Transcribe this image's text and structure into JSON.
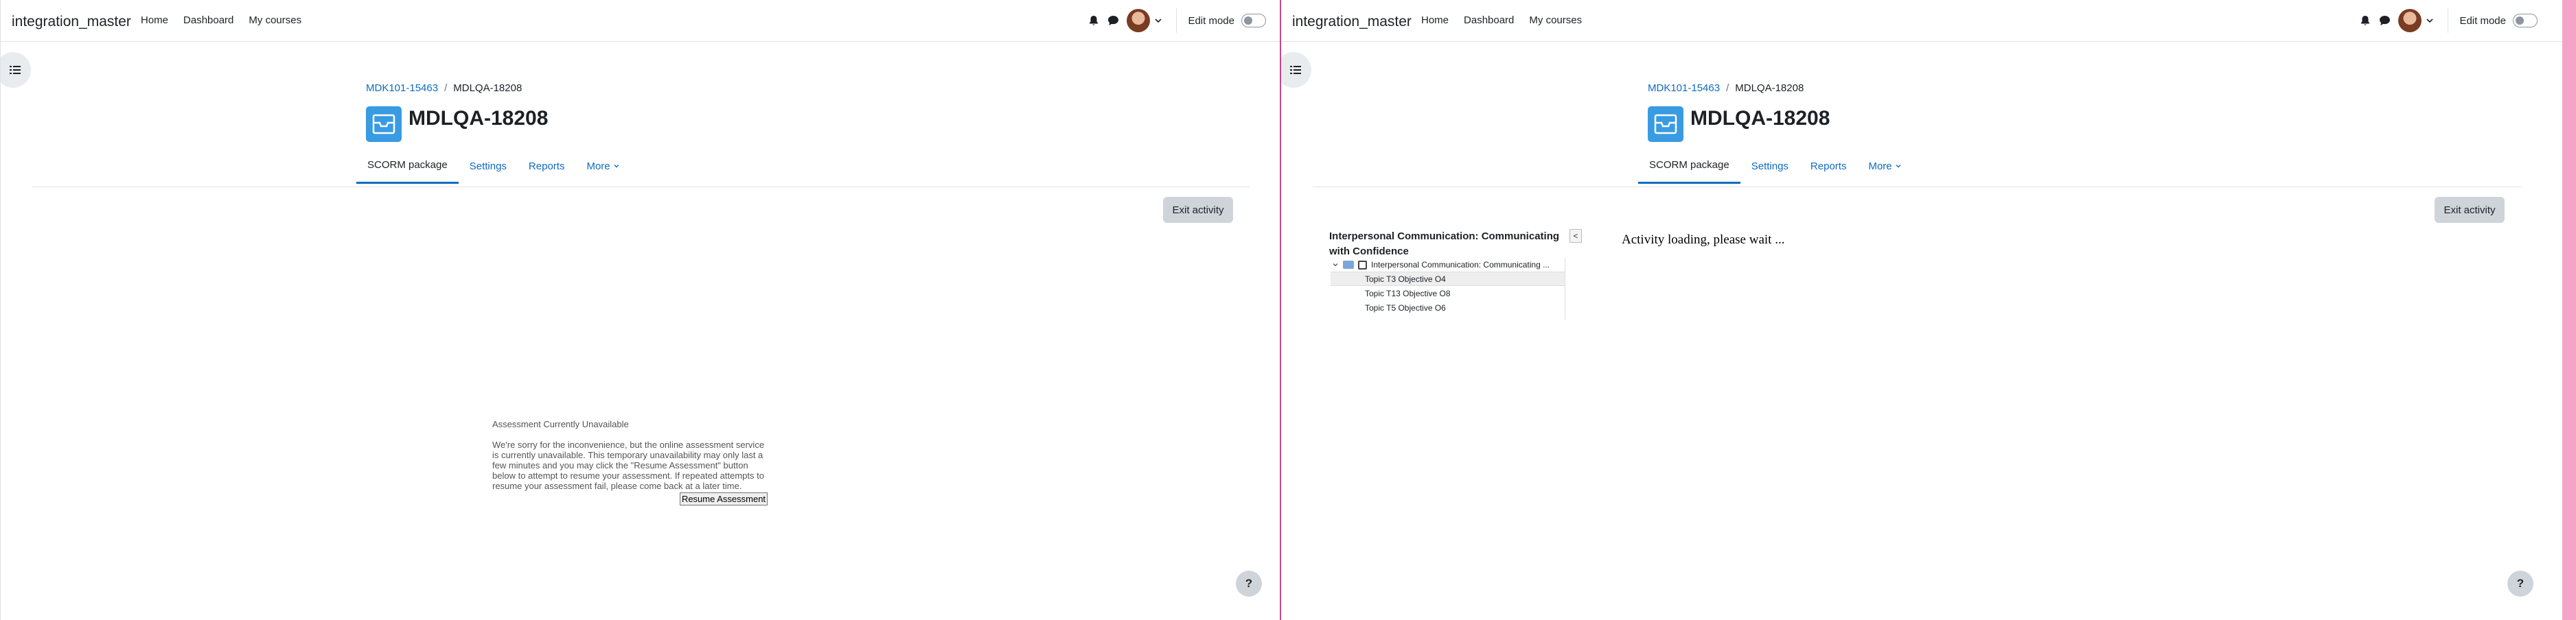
{
  "panes": [
    {
      "navbar": {
        "brand": "integration_master",
        "links": [
          "Home",
          "Dashboard",
          "My courses"
        ],
        "edit_mode_label": "Edit mode"
      },
      "breadcrumb": {
        "course": "MDK101-15463",
        "current": "MDLQA-18208"
      },
      "title": "MDLQA-18208",
      "tabs": [
        "SCORM package",
        "Settings",
        "Reports",
        "More"
      ],
      "active_tab": "SCORM package",
      "exit_label": "Exit activity",
      "help_label": "?",
      "notice": {
        "title": "Assessment Currently Unavailable",
        "body": "We're sorry for the inconvenience, but the online assessment service is currently unavailable.  This temporary unavailability may only last a few minutes and you may click the \"Resume Assessment\" button below to attempt to resume your assessment.  If repeated attempts to resume your assessment fail, please come back at a later time.",
        "button": "Resume Assessment"
      }
    },
    {
      "navbar": {
        "brand": "integration_master",
        "links": [
          "Home",
          "Dashboard",
          "My courses"
        ],
        "edit_mode_label": "Edit mode"
      },
      "breadcrumb": {
        "course": "MDK101-15463",
        "current": "MDLQA-18208"
      },
      "title": "MDLQA-18208",
      "tabs": [
        "SCORM package",
        "Settings",
        "Reports",
        "More"
      ],
      "active_tab": "SCORM package",
      "exit_label": "Exit activity",
      "help_label": "?",
      "toc": {
        "title": "Interpersonal Communication: Communicating with Confidence",
        "collapse_label": "<",
        "root": "Interpersonal Communication: Communicating ...",
        "items": [
          "Topic T3 Objective O4",
          "Topic T13 Objective O8",
          "Topic T5 Objective O6"
        ],
        "selected_index": 0
      },
      "loading_text": "Activity loading, please wait ..."
    }
  ],
  "colors": {
    "link": "#0f6cbf",
    "activity_icon": "#399be2",
    "split_bar": "#c8468a",
    "button_bg": "#ced4da"
  },
  "icons": [
    "bell-icon",
    "chat-icon",
    "chevron-down-icon",
    "drawer-list-icon",
    "scorm-box-icon",
    "folder-icon",
    "checkbox-icon"
  ]
}
